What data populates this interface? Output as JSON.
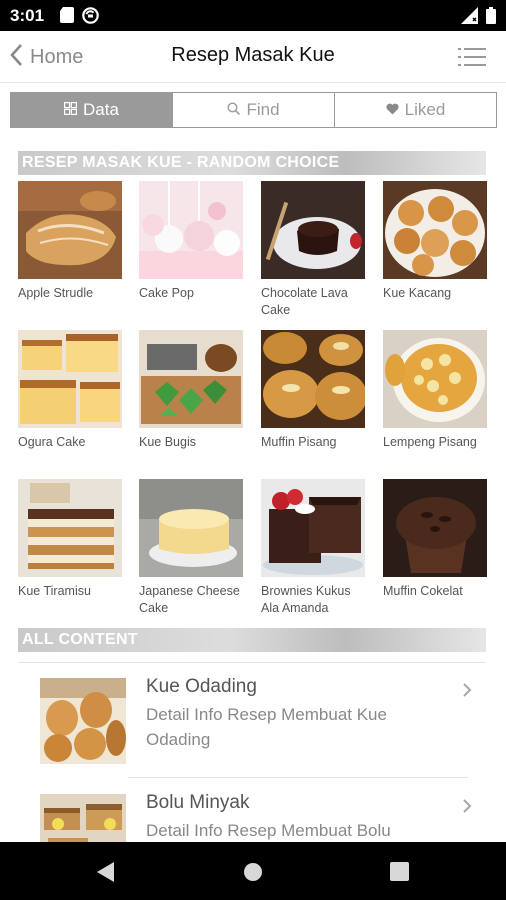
{
  "status_bar": {
    "time": "3:01",
    "left_icons": [
      "sd-card-icon",
      "do-not-disturb-icon"
    ],
    "right_icons": [
      "signal-icon",
      "battery-icon"
    ]
  },
  "app_bar": {
    "back_label": "Home",
    "title": "Resep Masak Kue",
    "menu_icon": "list-icon"
  },
  "segments": [
    {
      "label": "Data",
      "icon": "grid-icon",
      "active": true
    },
    {
      "label": "Find",
      "icon": "search-icon",
      "active": false
    },
    {
      "label": "Liked",
      "icon": "heart-icon",
      "active": false
    }
  ],
  "random": {
    "header": "RESEP MASAK KUE - RANDOM CHOICE",
    "items": [
      {
        "name": "Apple Strudle"
      },
      {
        "name": "Cake Pop"
      },
      {
        "name": "Chocolate Lava Cake"
      },
      {
        "name": "Kue Kacang"
      },
      {
        "name": "Ogura Cake"
      },
      {
        "name": "Kue Bugis"
      },
      {
        "name": "Muffin Pisang"
      },
      {
        "name": "Lempeng Pisang"
      },
      {
        "name": "Kue Tiramisu"
      },
      {
        "name": "Japanese Cheese Cake"
      },
      {
        "name": "Brownies Kukus Ala Amanda"
      },
      {
        "name": "Muffin Cokelat"
      }
    ]
  },
  "all_content": {
    "header": "ALL CONTENT",
    "items": [
      {
        "title": "Kue Odading",
        "desc": "Detail Info Resep Membuat Kue Odading"
      },
      {
        "title": "Bolu Minyak",
        "desc": "Detail Info Resep Membuat Bolu"
      }
    ]
  },
  "colors": {
    "segment_active": "#9a9a9a",
    "header_gradient": "#c9c9c9"
  }
}
